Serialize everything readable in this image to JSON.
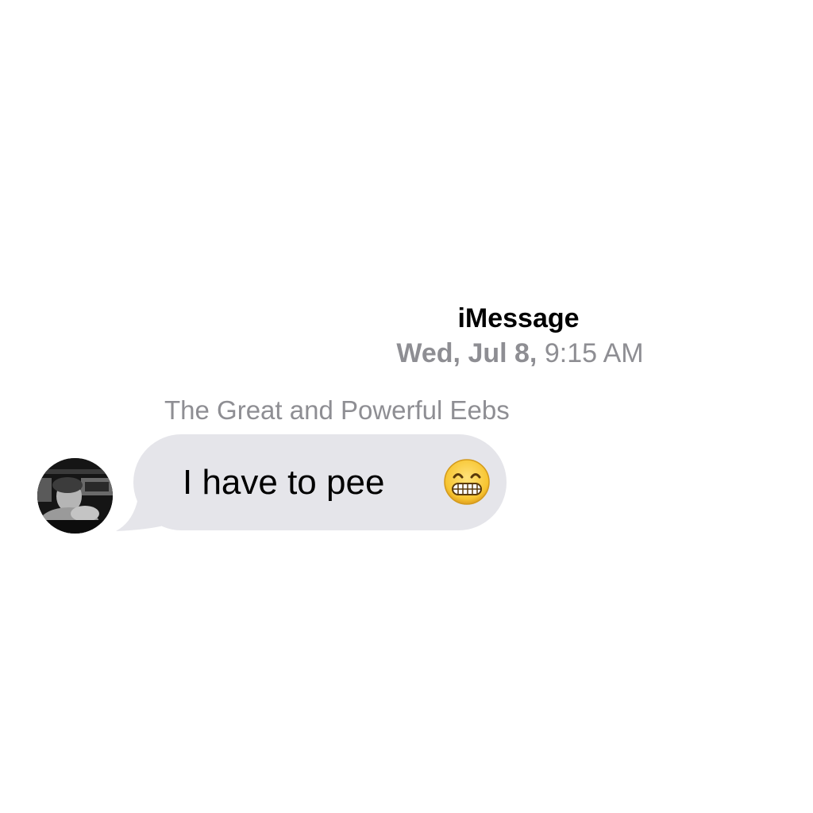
{
  "conversation_header": {
    "service": "iMessage",
    "date": "Wed, Jul 8,",
    "time": "9:15 AM"
  },
  "message": {
    "sender_name": "The Great and Powerful Eebs",
    "text": "I have to pee",
    "emoji": "grimacing-face-emoji",
    "avatar": "contact-avatar-photo"
  },
  "colors": {
    "bubble_incoming": "#e5e5ea",
    "secondary_text": "#8e8e93",
    "message_text": "#000000",
    "background": "#ffffff"
  }
}
